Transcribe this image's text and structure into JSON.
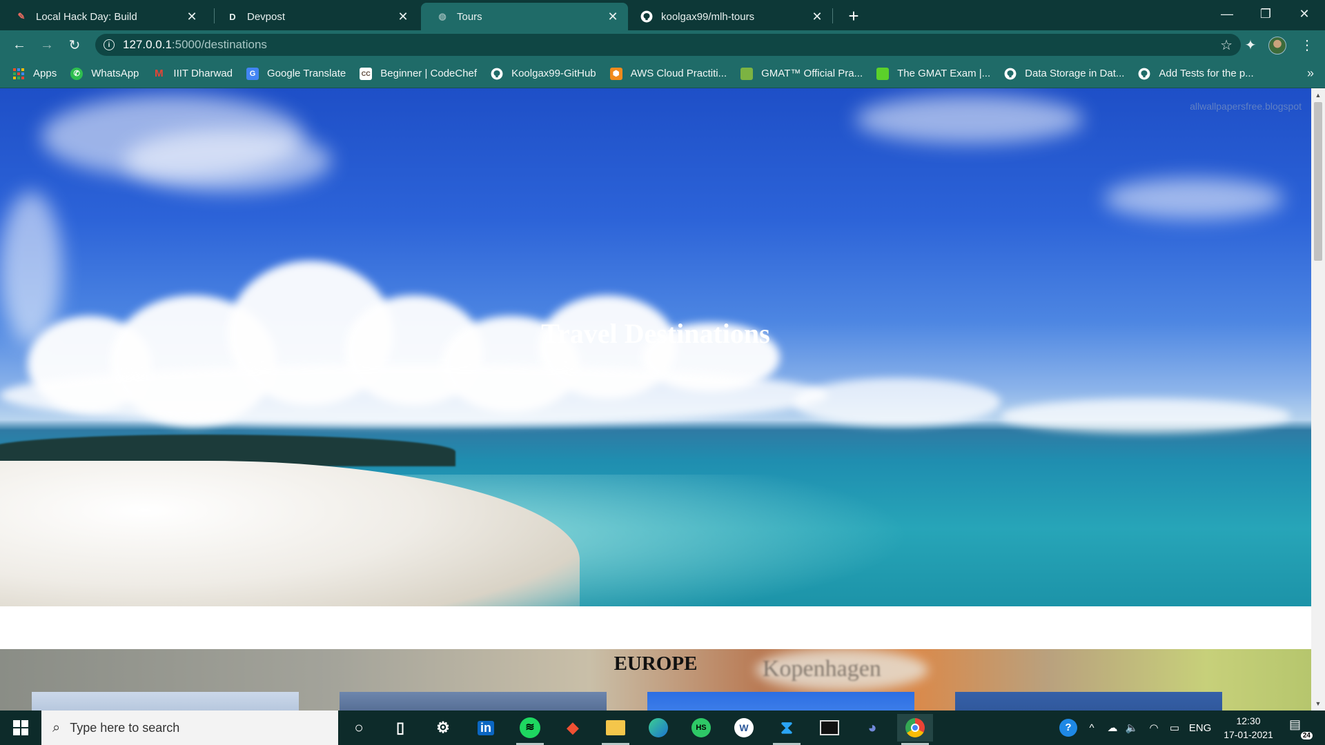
{
  "tabs": [
    {
      "title": "Local Hack Day: Build",
      "icon": "mlh-icon",
      "active": false
    },
    {
      "title": "Devpost",
      "icon": "devpost-icon",
      "active": false
    },
    {
      "title": "Tours",
      "icon": "globe-icon",
      "active": true
    },
    {
      "title": "koolgax99/mlh-tours",
      "icon": "github-icon",
      "active": false
    }
  ],
  "toolbar": {
    "url_host": "127.0.0.1",
    "url_path": ":5000/destinations"
  },
  "bookmarks": [
    {
      "label": "Apps",
      "icon": "apps-grid-icon"
    },
    {
      "label": "WhatsApp",
      "icon": "whatsapp-icon"
    },
    {
      "label": "IIIT Dharwad",
      "icon": "gmail-icon"
    },
    {
      "label": "Google Translate",
      "icon": "google-translate-icon"
    },
    {
      "label": "Beginner | CodeChef",
      "icon": "codechef-icon"
    },
    {
      "label": "Koolgax99-GitHub",
      "icon": "github-icon"
    },
    {
      "label": "AWS Cloud Practiti...",
      "icon": "aws-icon"
    },
    {
      "label": "GMAT™ Official Pra...",
      "icon": "gmat-icon"
    },
    {
      "label": "The GMAT Exam |...",
      "icon": "gmat-green-icon"
    },
    {
      "label": "Data Storage in Dat...",
      "icon": "github-icon"
    },
    {
      "label": "Add Tests for the p...",
      "icon": "github-icon"
    }
  ],
  "page": {
    "hero_title": "Travel Destinations",
    "watermark": "allwallpapersfree.blogspot",
    "section_title": "EUROPE",
    "section_bg_sign": "Kopenhagen"
  },
  "taskbar": {
    "search_placeholder": "Type here to search",
    "language": "ENG",
    "time": "12:30",
    "date": "17-01-2021",
    "notification_count": "24",
    "apps": [
      "cortana-icon",
      "task-view-icon",
      "settings-icon",
      "linkedin-icon",
      "spotify-icon",
      "git-icon",
      "file-explorer-icon",
      "edge-icon",
      "hackerrank-icon",
      "word-icon",
      "vscode-icon",
      "terminal-icon",
      "discord-icon",
      "chrome-icon"
    ]
  },
  "colors": {
    "tab_strip": "#0d3837",
    "toolbar": "#1f6b68",
    "taskbar": "#0d2b2a"
  }
}
